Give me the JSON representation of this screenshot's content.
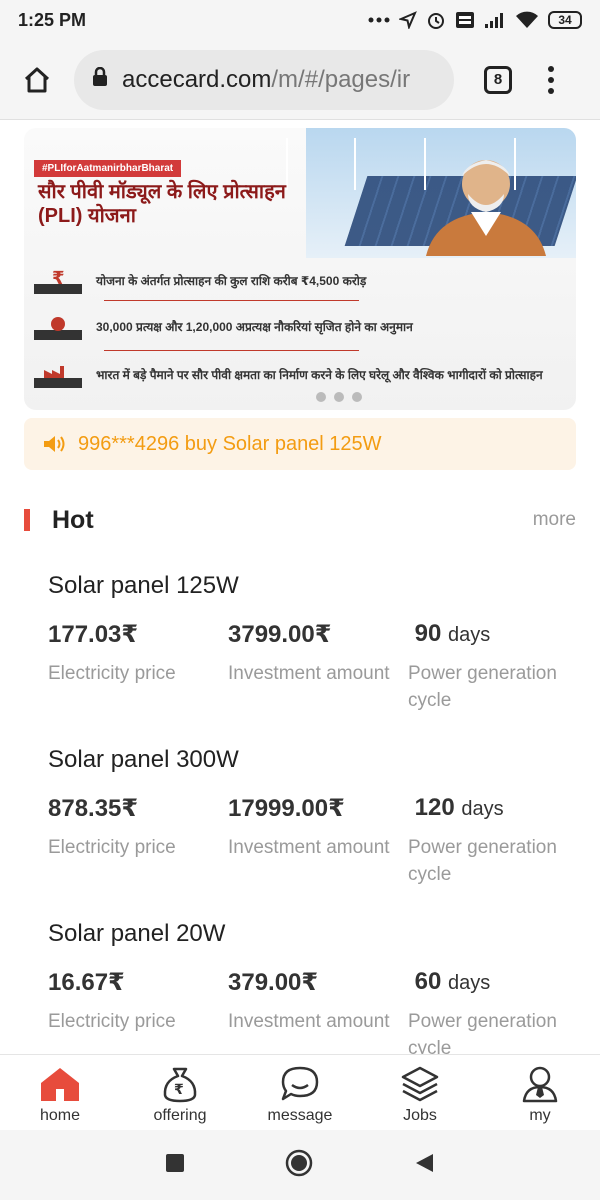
{
  "status_bar": {
    "time": "1:25 PM",
    "battery": "34"
  },
  "browser": {
    "url_domain": "accecard.com",
    "url_path": "/m/#/pages/ir",
    "tab_count": "8"
  },
  "banner": {
    "tagline": "#PLIforAatmanirbharBharat",
    "headline": "सौर पीवी मॉड्यूल के लिए प्रोत्साहन (PLI) योजना",
    "items": [
      "योजना के अंतर्गत प्रोत्साहन की कुल राशि करीब ₹4,500 करोड़",
      "30,000 प्रत्यक्ष और 1,20,000 अप्रत्यक्ष नौकरियां सृजित होने का अनुमान",
      "भारत में बड़े पैमाने पर सौर पीवी क्षमता का निर्माण करने के लिए घरेलू और वैश्विक भागीदारों को प्रोत्साहन"
    ]
  },
  "notice": {
    "text": "996***4296 buy Solar panel 125W"
  },
  "hot": {
    "title": "Hot",
    "more": "more"
  },
  "products": [
    {
      "name": "Solar panel 125W",
      "price": "177.03₹",
      "price_label": "Electricity price",
      "investment": "3799.00₹",
      "investment_label": "Investment amount",
      "cycle_value": "90",
      "cycle_unit": "days",
      "cycle_label": "Power generation cycle"
    },
    {
      "name": "Solar panel 300W",
      "price": "878.35₹",
      "price_label": "Electricity price",
      "investment": "17999.00₹",
      "investment_label": "Investment amount",
      "cycle_value": "120",
      "cycle_unit": "days",
      "cycle_label": "Power generation cycle"
    },
    {
      "name": "Solar panel 20W",
      "price": "16.67₹",
      "price_label": "Electricity price",
      "investment": "379.00₹",
      "investment_label": "Investment amount",
      "cycle_value": "60",
      "cycle_unit": "days",
      "cycle_label": "Power generation cycle"
    }
  ],
  "bottom_nav": [
    {
      "label": "home",
      "icon": "home-icon",
      "active": true
    },
    {
      "label": "offering",
      "icon": "money-bag-icon",
      "active": false
    },
    {
      "label": "message",
      "icon": "chat-bubble-icon",
      "active": false
    },
    {
      "label": "Jobs",
      "icon": "layers-icon",
      "active": false
    },
    {
      "label": "my",
      "icon": "person-icon",
      "active": false
    }
  ],
  "colors": {
    "accent": "#e74c3c",
    "notice_text": "#f39c12",
    "notice_bg": "#fdf3e6"
  }
}
